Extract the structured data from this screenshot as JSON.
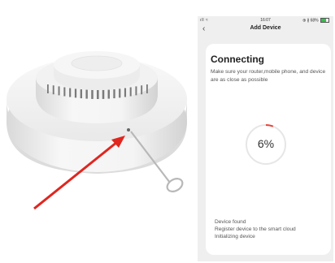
{
  "status_bar": {
    "signal": "ıll ≈",
    "time": "16:07",
    "battery": "⊕ ∦ 68%"
  },
  "nav": {
    "back_icon": "‹",
    "title": "Add Device"
  },
  "card": {
    "heading": "Connecting",
    "description": "Make sure your router,mobile phone, and device are as close as possible",
    "progress_text": "6%",
    "progress_value": 0.06,
    "steps": [
      "Device found",
      "Register device to the smart cloud",
      "Initializing device"
    ]
  },
  "colors": {
    "progress_arc": "#e8453c",
    "progress_track": "#e6e6e6",
    "arrow": "#e0261f",
    "battery": "#35c04a"
  },
  "icons": {
    "back": "chevron-left-icon",
    "arrow": "red-arrow-icon"
  }
}
